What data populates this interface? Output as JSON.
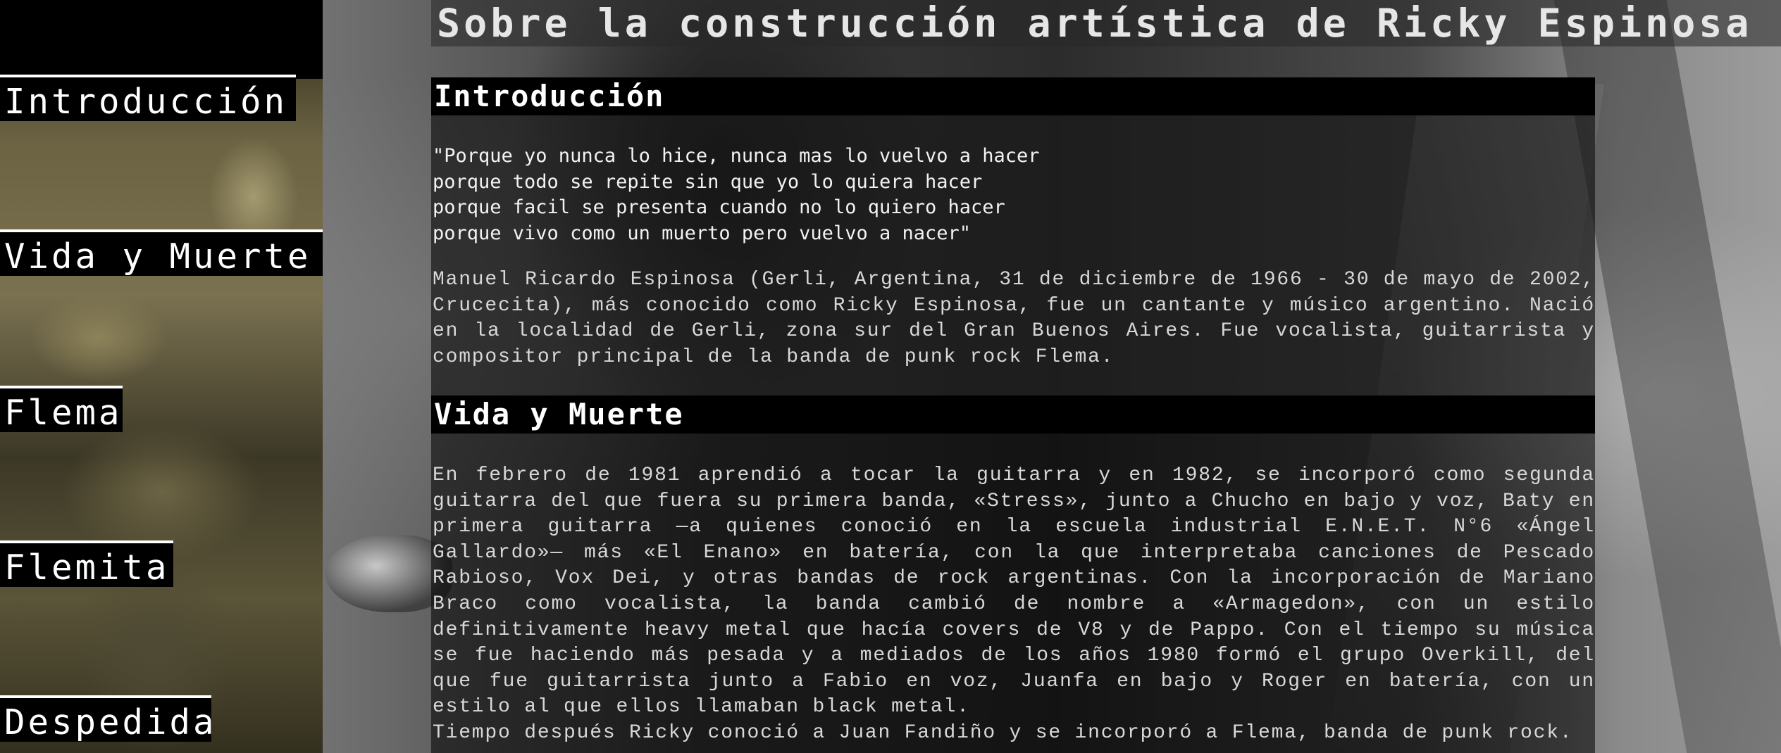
{
  "page": {
    "title": "Sobre la construcción artística de Ricky Espinosa"
  },
  "sidebar": {
    "items": [
      {
        "label": "Introducción"
      },
      {
        "label": "Vida y Muerte"
      },
      {
        "label": "Flema"
      },
      {
        "label": "Flemita"
      },
      {
        "label": "Despedida"
      }
    ]
  },
  "sections": {
    "intro": {
      "heading": "Introducción",
      "poem": [
        "\"Porque yo nunca lo hice, nunca mas lo vuelvo a hacer",
        "porque todo se repite sin que yo lo quiera hacer",
        "porque facil se presenta cuando no lo quiero hacer",
        "porque vivo como un muerto pero vuelvo a nacer\""
      ],
      "paragraph": "Manuel Ricardo Espinosa (Gerli, Argentina, 31 de diciembre de 1966 - 30 de mayo de 2002, Crucecita), más conocido como Ricky Espinosa, fue un cantante y músico argentino. Nació en la localidad de Gerli, zona sur del Gran Buenos Aires. Fue vocalista, guitarrista y compositor principal de la banda de punk rock Flema."
    },
    "vida": {
      "heading": "Vida y Muerte",
      "paragraph1": "En febrero de 1981 aprendió a tocar la guitarra y en 1982, se incorporó como segunda guitarra del que fuera su primera banda, «Stress», junto a Chucho en bajo y voz, Baty en primera guitarra —a quienes conoció en la escuela industrial E.N.E.T. N°6 «Ángel Gallardo»— más «El Enano» en batería, con la que interpretaba canciones de Pescado Rabioso, Vox Dei, y otras bandas de rock argentinas. Con la incorporación de Mariano Braco como vocalista, la banda cambió de nombre a «Armagedon», con un estilo definitivamente heavy metal que hacía covers de V8 y de Pappo. Con el tiempo su música se fue haciendo más pesada y a mediados de los años 1980 formó el grupo Overkill, del que fue guitarrista junto a Fabio en voz, Juanfa en bajo y Roger en batería, con un estilo al que ellos llamaban black metal.",
      "paragraph2": "Tiempo después Ricky conoció a Juan Fandiño y se incorporó a Flema, banda de punk rock."
    }
  }
}
